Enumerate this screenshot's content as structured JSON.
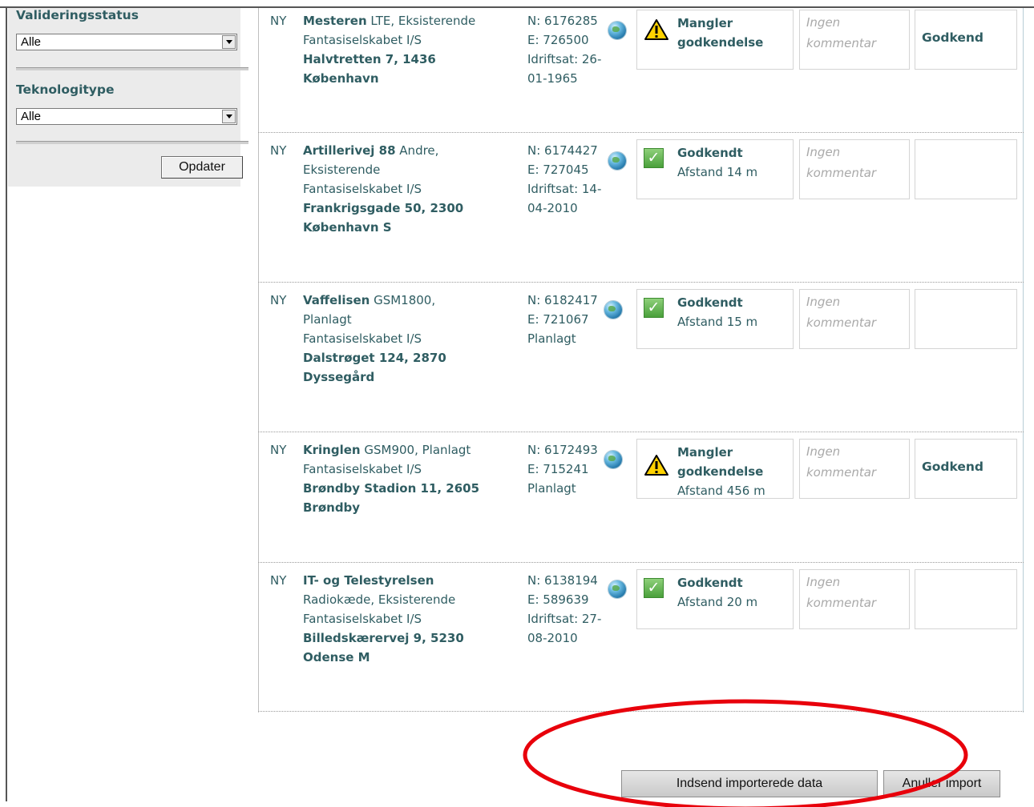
{
  "sidebar": {
    "validation_label": "Valideringsstatus",
    "validation_value": "Alle",
    "technology_label": "Teknologitype",
    "technology_value": "Alle",
    "update_button": "Opdater"
  },
  "rows": [
    {
      "status_tag": "NY",
      "name": "Mesteren",
      "type_line1": "LTE, Eksisterende",
      "company": "Fantasiselskabet I/S",
      "address1": "Halvtretten 7, 1436",
      "address2": "København",
      "north": "N: 6176285",
      "east": "E: 726500",
      "date1": "Idriftsat: 26-",
      "date2": "01-1965",
      "validation_icon": "warning-icon",
      "validation1": "Mangler",
      "validation2": "godkendelse",
      "distance": "",
      "comment1": "Ingen",
      "comment2": "kommentar",
      "action": "Godkend"
    },
    {
      "status_tag": "NY",
      "name": "Artillerivej 88",
      "type_line1": "Andre,",
      "type_line2": "Eksisterende",
      "company": "Fantasiselskabet I/S",
      "address1": "Frankrigsgade 50, 2300",
      "address2": "København S",
      "north": "N: 6174427",
      "east": "E: 727045",
      "date1": "Idriftsat: 14-",
      "date2": "04-2010",
      "validation_icon": "check-icon",
      "validation1": "Godkendt",
      "distance": "Afstand 14 m",
      "comment1": "Ingen",
      "comment2": "kommentar",
      "action": ""
    },
    {
      "status_tag": "NY",
      "name": "Vaffelisen",
      "type_line1": "GSM1800,",
      "type_line2": "Planlagt",
      "company": "Fantasiselskabet I/S",
      "address1": "Dalstrøget 124, 2870",
      "address2": "Dyssegård",
      "north": "N: 6182417",
      "east": "E: 721067",
      "date1": "Planlagt",
      "validation_icon": "check-icon",
      "validation1": "Godkendt",
      "distance": "Afstand 15 m",
      "comment1": "Ingen",
      "comment2": "kommentar",
      "action": ""
    },
    {
      "status_tag": "NY",
      "name": "Kringlen",
      "type_line1": "GSM900, Planlagt",
      "company": "Fantasiselskabet I/S",
      "address1": "Brøndby Stadion 11, 2605",
      "address2": "Brøndby",
      "north": "N: 6172493",
      "east": "E: 715241",
      "date1": "Planlagt",
      "validation_icon": "warning-icon",
      "validation1": "Mangler",
      "validation2": "godkendelse",
      "distance": "Afstand 456 m",
      "comment1": "Ingen",
      "comment2": "kommentar",
      "action": "Godkend"
    },
    {
      "status_tag": "NY",
      "name": "IT- og Telestyrelsen",
      "type_line1": "Radiokæde, Eksisterende",
      "company": "Fantasiselskabet I/S",
      "address1": "Billedskærervej 9, 5230",
      "address2": "Odense M",
      "north": "N: 6138194",
      "east": "E: 589639",
      "date1": "Idriftsat: 27-",
      "date2": "08-2010",
      "validation_icon": "check-icon",
      "validation1": "Godkendt",
      "distance": "Afstand 20 m",
      "comment1": "Ingen",
      "comment2": "kommentar",
      "action": ""
    }
  ],
  "footer": {
    "submit_button": "Indsend importerede data",
    "cancel_button": "Anuller import"
  },
  "colors": {
    "text": "#2f5d62",
    "annotation": "#e8000b"
  }
}
